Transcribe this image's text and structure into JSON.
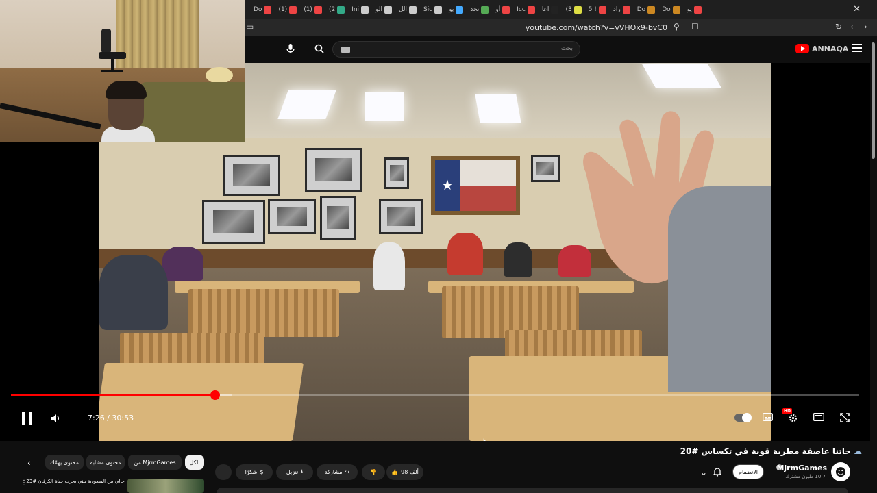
{
  "browser": {
    "tabs": [
      {
        "label": "Do",
        "color": "#e44"
      },
      {
        "label": "(1)",
        "color": "#e44"
      },
      {
        "label": "(1)",
        "color": "#e44"
      },
      {
        "label": "(2",
        "color": "#3a8"
      },
      {
        "label": "Ini",
        "color": "#ccc"
      },
      {
        "label": "الو",
        "color": "#ccc"
      },
      {
        "label": "الل",
        "color": "#ccc"
      },
      {
        "label": "Sic",
        "color": "#ccc"
      },
      {
        "label": "يو",
        "color": "#4af"
      },
      {
        "label": "تحد",
        "color": "#5a5"
      },
      {
        "label": "أو",
        "color": "#e44"
      },
      {
        "label": "Icc",
        "color": "#e44"
      },
      {
        "label": "اعا",
        "color": "#222"
      },
      {
        "label": "(3",
        "color": "#dd4"
      },
      {
        "label": "5 !",
        "color": "#e44"
      },
      {
        "label": "راد",
        "color": "#e44"
      },
      {
        "label": "Do",
        "color": "#c82"
      },
      {
        "label": "Do",
        "color": "#c82"
      },
      {
        "label": "يو",
        "color": "#e44"
      }
    ],
    "close_tab_glyph": "✕",
    "url": "youtube.com/watch?v=vVHOx9-bvC0"
  },
  "header": {
    "search_placeholder": "بحث",
    "logo_text": "ANNAQA"
  },
  "player": {
    "current_time": "7:26",
    "duration": "30:53",
    "time_display": "7:26 / 30:53",
    "progress_fraction": 0.241,
    "buffered_fraction": 0.26,
    "hd_badge": "HD",
    "accent_color": "#ff0000"
  },
  "video_info": {
    "title": "جاتنا عاصفة مطرية قوية في تكساس #20",
    "channel_name": "MjrmGames",
    "subscribers": "10.7 مليون مشترك",
    "join_label": "الانضمام",
    "likes_label": "98 ألف",
    "share_label": "مشاركة",
    "download_label": "تنزيل",
    "thanks_label": "شكرًا",
    "more_label": "⋯"
  },
  "chips": {
    "all": "الكل",
    "from_channel": "من MjrmGames",
    "similar": "محتوى مشابه",
    "for_you": "محتوى يهمّك"
  },
  "recommendation": {
    "title": "خالي من السعودية ييني يجرب حياة الكرفان #23"
  }
}
